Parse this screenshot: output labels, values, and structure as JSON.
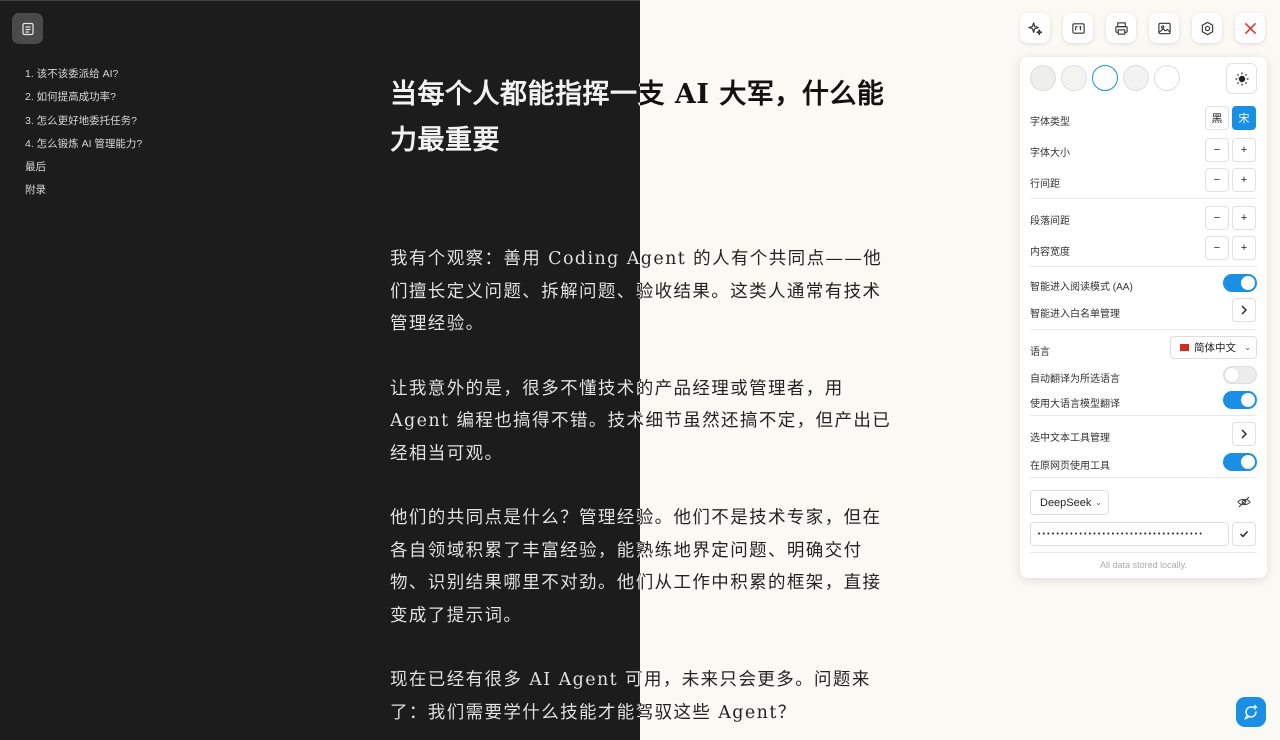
{
  "toc": {
    "items": [
      "1. 该不该委派给 AI?",
      "2. 如何提高成功率?",
      "3. 怎么更好地委托任务?",
      "4. 怎么锻炼 AI 管理能力?",
      "最后",
      "附录"
    ]
  },
  "article": {
    "title": "当每个人都能指挥一支 AI 大军，什么能力最重要",
    "paragraphs": [
      "我有个观察：善用 Coding Agent 的人有个共同点——他们擅长定义问题、拆解问题、验收结果。这类人通常有技术管理经验。",
      "让我意外的是，很多不懂技术的产品经理或管理者，用 Agent 编程也搞得不错。技术细节虽然还搞不定，但产出已经相当可观。",
      "他们的共同点是什么？管理经验。他们不是技术专家，但在各自领域积累了丰富经验，能熟练地界定问题、明确交付物、识别结果哪里不对劲。他们从工作中积累的框架，直接变成了提示词。",
      "现在已经有很多 AI Agent 可用，未来只会更多。问题来了：我们需要学什么技能才能驾驭这些 Agent？"
    ]
  },
  "toolbar": {
    "icons": [
      "sparkles-icon",
      "translate-icon",
      "print-icon",
      "image-icon",
      "settings-icon",
      "close-icon"
    ]
  },
  "settings": {
    "theme_colors": [
      "#eeeeea",
      "#f3f3ef",
      "#ffffff",
      "#f2f2f2",
      "#ffffff"
    ],
    "font_type_label": "字体类型",
    "font_sans": "黑",
    "font_serif": "宋",
    "font_size_label": "字体大小",
    "line_height_label": "行间距",
    "paragraph_spacing_label": "段落间距",
    "content_width_label": "内容宽度",
    "minus": "−",
    "plus": "+",
    "auto_reader_label": "智能进入阅读模式 (AA)",
    "whitelist_label": "智能进入白名单管理",
    "language_label": "语言",
    "language_value": "简体中文",
    "auto_translate_label": "自动翻译为所选语言",
    "llm_translate_label": "使用大语言模型翻译",
    "selection_tools_label": "选中文本工具管理",
    "use_tools_label": "在原网页使用工具",
    "model_value": "DeepSeek",
    "api_key_value": "••••••••••••••••••••••••••••••••••••",
    "footer_note": "All data stored locally.",
    "toggles": {
      "auto_reader": true,
      "auto_translate": false,
      "llm_translate": true,
      "use_tools": true
    },
    "accent_color": "#1a8fe3"
  }
}
